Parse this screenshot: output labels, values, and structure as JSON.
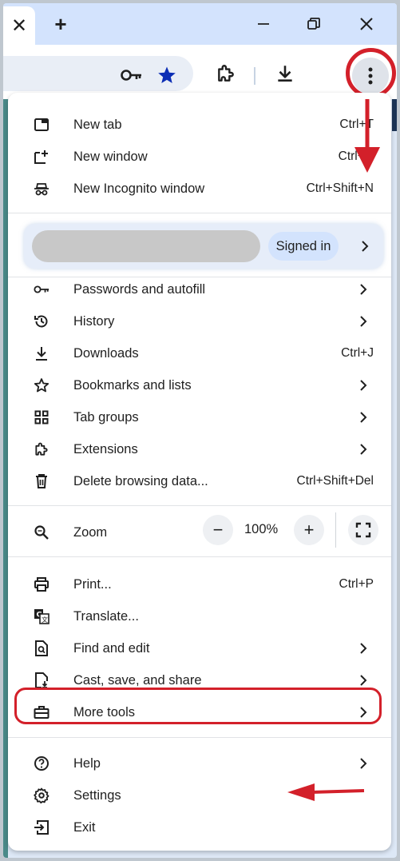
{
  "tabstrip": {
    "close_tab_glyph": "✕",
    "new_tab_glyph": "+"
  },
  "menu": {
    "section1": [
      {
        "label": "New tab",
        "shortcut": "Ctrl+T",
        "icon": "new-tab-icon"
      },
      {
        "label": "New window",
        "shortcut": "Ctrl+N",
        "icon": "new-window-icon"
      },
      {
        "label": "New Incognito window",
        "shortcut": "Ctrl+Shift+N",
        "icon": "incognito-icon"
      }
    ],
    "profile": {
      "signed_in_label": "Signed in"
    },
    "section2": [
      {
        "label": "Passwords and autofill",
        "icon": "key-icon"
      },
      {
        "label": "History",
        "icon": "history-icon"
      },
      {
        "label": "Downloads",
        "shortcut": "Ctrl+J",
        "icon": "download-icon"
      },
      {
        "label": "Bookmarks and lists",
        "icon": "star-icon"
      },
      {
        "label": "Tab groups",
        "icon": "tab-groups-icon"
      },
      {
        "label": "Extensions",
        "icon": "puzzle-icon"
      },
      {
        "label": "Delete browsing data...",
        "shortcut": "Ctrl+Shift+Del",
        "icon": "trash-icon"
      }
    ],
    "zoom": {
      "label": "Zoom",
      "value": "100%",
      "minus": "−",
      "plus": "+"
    },
    "section3": [
      {
        "label": "Print...",
        "shortcut": "Ctrl+P",
        "icon": "printer-icon"
      },
      {
        "label": "Translate...",
        "icon": "translate-icon"
      },
      {
        "label": "Find and edit",
        "icon": "find-icon"
      },
      {
        "label": "Cast, save, and share",
        "icon": "cast-save-icon"
      },
      {
        "label": "More tools",
        "icon": "toolbox-icon"
      }
    ],
    "section4": [
      {
        "label": "Help",
        "icon": "help-icon"
      },
      {
        "label": "Settings",
        "icon": "gear-icon"
      },
      {
        "label": "Exit",
        "icon": "exit-icon"
      }
    ]
  },
  "colors": {
    "annotation_red": "#d3202a",
    "tabstrip_bg": "#d3e3fd",
    "bookmark_star": "#0b2db5"
  }
}
